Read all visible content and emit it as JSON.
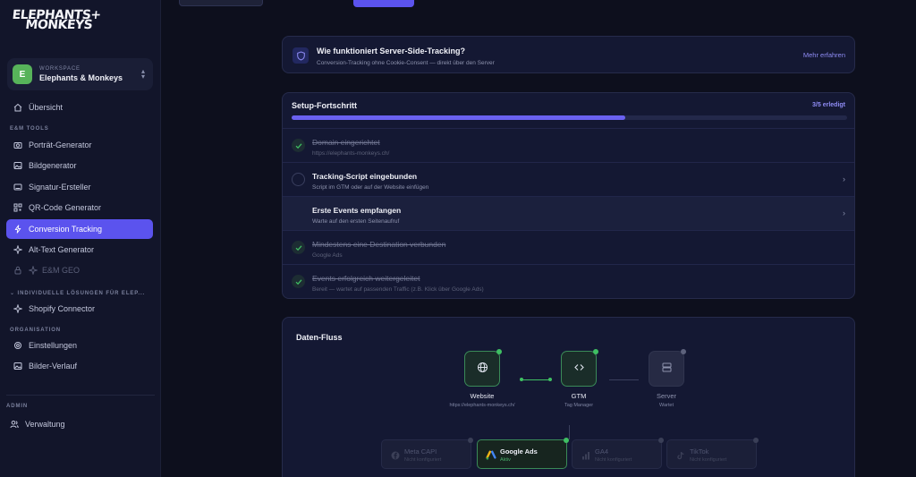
{
  "brand": {
    "logo_line1": "ELEPHANTS+",
    "logo_line2": "MONKEYS"
  },
  "workspace": {
    "label": "WORKSPACE",
    "name": "Elephants & Monkeys",
    "avatar": "E"
  },
  "sidebar": {
    "overview": "Übersicht",
    "tools_label": "E&M TOOLS",
    "tools": [
      {
        "label": "Porträt-Generator",
        "icon": "camera-icon"
      },
      {
        "label": "Bildgenerator",
        "icon": "image-icon"
      },
      {
        "label": "Signatur-Ersteller",
        "icon": "signature-icon"
      },
      {
        "label": "QR-Code Generator",
        "icon": "qr-code-icon"
      },
      {
        "label": "Conversion Tracking",
        "icon": "bolt-icon",
        "active": true
      },
      {
        "label": "Alt-Text Generator",
        "icon": "sparkle-icon"
      },
      {
        "label": "E&M GEO",
        "icon": "sparkle-icon",
        "locked": true
      }
    ],
    "individual_label": "INDIVIDUELLE LÖSUNGEN FÜR ELEP...",
    "shopify": "Shopify Connector",
    "org_label": "ORGANISATION",
    "settings": "Einstellungen",
    "history": "Bilder-Verlauf",
    "admin_label": "ADMIN",
    "admin": "Verwaltung"
  },
  "topbar": {
    "pill": "",
    "tabs": [
      "",
      "",
      "",
      "",
      "",
      "",
      "",
      ""
    ]
  },
  "info": {
    "title": "Wie funktioniert Server-Side-Tracking?",
    "subtitle": "Conversion-Tracking ohne Cookie-Consent — direkt über den Server",
    "link": "Mehr erfahren"
  },
  "setup": {
    "title": "Setup-Fortschritt",
    "count": "3/5 erledigt",
    "progress": 0.6,
    "steps": [
      {
        "title": "Domain eingerichtet",
        "sub": "https://elephants-monkeys.ch/",
        "done": true
      },
      {
        "title": "Tracking-Script eingebunden",
        "sub": "Script im GTM oder auf der Website einfügen",
        "done": false
      },
      {
        "title": "Erste Events empfangen",
        "sub": "Warte auf den ersten Seitenaufruf",
        "done": false
      },
      {
        "title": "Mindestens eine Destination verbunden",
        "sub": "Google Ads",
        "done": true
      },
      {
        "title": "Events erfolgreich weitergeleitet",
        "sub": "Bereit — wartet auf passenden Traffic (z.B. Klick über Google Ads)",
        "done": true
      }
    ]
  },
  "flow": {
    "title": "Daten-Fluss",
    "nodes": [
      {
        "label": "Website",
        "sub": "https://elephants-monkeys.ch/"
      },
      {
        "label": "GTM",
        "sub": "Tag Manager"
      },
      {
        "label": "Server",
        "sub": "Wartet"
      }
    ],
    "destinations": [
      {
        "name": "Meta CAPI",
        "status": "Nicht konfiguriert"
      },
      {
        "name": "Google Ads",
        "status": "Aktiv"
      },
      {
        "name": "GA4",
        "status": "Nicht konfiguriert"
      },
      {
        "name": "TikTok",
        "status": "Nicht konfiguriert"
      }
    ]
  },
  "colors": {
    "accent": "#5b53ee",
    "success": "#3fbf63",
    "background": "#0d0f1d"
  }
}
